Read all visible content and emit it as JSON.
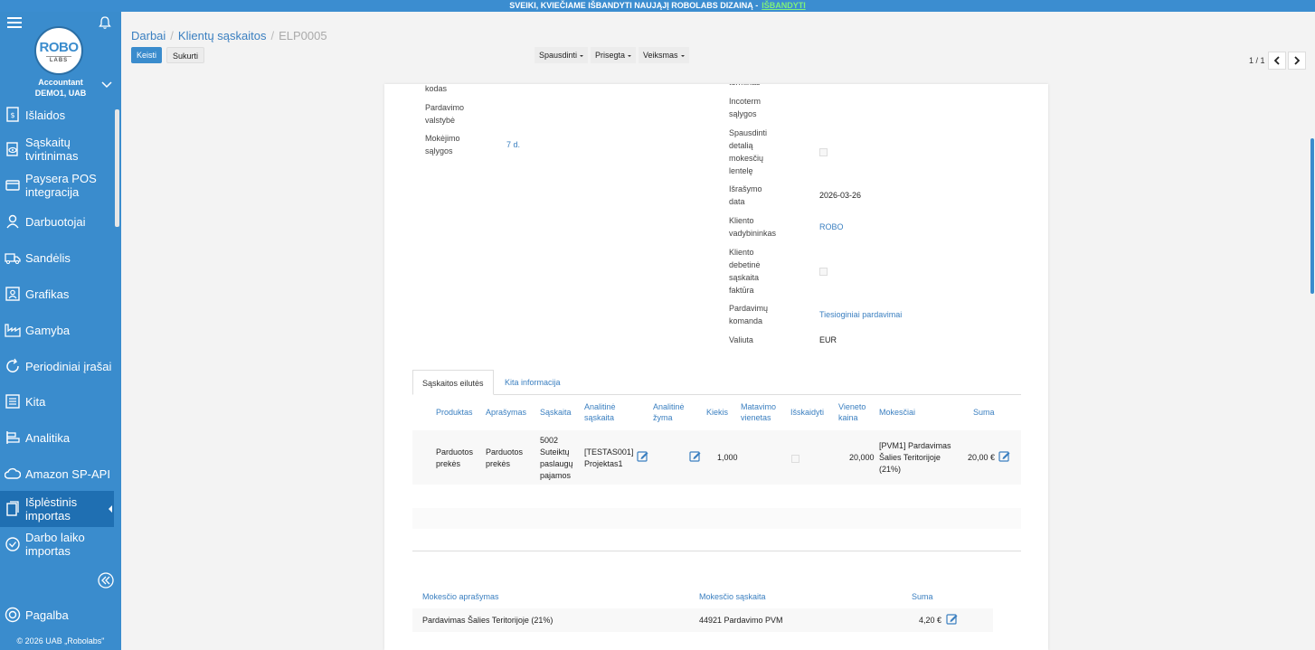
{
  "banner": {
    "text": "SVEIKI, KVIEČIAME IŠBANDYTI NAUJĄJĮ ROBOLABS DIZAINĄ -",
    "link": "IŠBANDYTI"
  },
  "sidebar": {
    "logo_top": "ROBO",
    "logo_bottom": "LABS",
    "role": "Accountant",
    "company": "DEMO1, UAB",
    "items": [
      {
        "label": "Išlaidos",
        "icon": "receipt-icon"
      },
      {
        "label": "Sąskaitų tvirtinimas",
        "icon": "eye-document-icon"
      },
      {
        "label": "Paysera POS integracija",
        "icon": "card-icon"
      },
      {
        "label": "Darbuotojai",
        "icon": "person-icon"
      },
      {
        "label": "Sandėlis",
        "icon": "truck-icon"
      },
      {
        "label": "Grafikas",
        "icon": "calendar-person-icon"
      },
      {
        "label": "Gamyba",
        "icon": "factory-icon"
      },
      {
        "label": "Periodiniai įrašai",
        "icon": "refresh-icon"
      },
      {
        "label": "Kita",
        "icon": "list-icon"
      },
      {
        "label": "Analitika",
        "icon": "analytics-icon"
      },
      {
        "label": "Amazon SP-API",
        "icon": "cloud-icon"
      },
      {
        "label": "Išplėstinis importas",
        "icon": "import-icon"
      },
      {
        "label": "Darbo laiko importas",
        "icon": "clock-icon"
      }
    ],
    "help": "Pagalba",
    "copyright": "© 2026 UAB „Robolabs\""
  },
  "header": {
    "breadcrumb": [
      "Darbai",
      "Klientų sąskaitos",
      "ELP0005"
    ],
    "edit_label": "Keisti",
    "create_label": "Sukurti",
    "print_label": "Spausdinti",
    "attach_label": "Prisegta",
    "action_label": "Veiksmas",
    "pager": "1 / 1"
  },
  "form": {
    "left": {
      "code_label": "kodas",
      "country_label": "Pardavimo valstybė",
      "payment_label": "Mokėjimo sąlygos",
      "payment_value": "7 d."
    },
    "right": {
      "term_label": "terminas",
      "incoterm_label": "Incoterm sąlygos",
      "print_tax_label": "Spausdinti detalią mokesčių lentelę",
      "date_label": "Išrašymo data",
      "date_value": "2026-03-26",
      "manager_label": "Kliento vadybininkas",
      "manager_value": "ROBO",
      "debit_label": "Kliento debetinė sąskaita faktūra",
      "team_label": "Pardavimų komanda",
      "team_value": "Tiesioginiai pardavimai",
      "currency_label": "Valiuta",
      "currency_value": "EUR"
    }
  },
  "tabs": [
    "Sąskaitos eilutės",
    "Kita informacija"
  ],
  "lines": {
    "headers": [
      "Produktas",
      "Aprašymas",
      "Sąskaita",
      "Analitinė sąskaita",
      "Analitinė žyma",
      "Kiekis",
      "Matavimo vienetas",
      "Išskaidyti",
      "Vieneto kaina",
      "Mokesčiai",
      "Suma"
    ],
    "row": {
      "product": "Parduotos prekės",
      "description": "Parduotos prekės",
      "account": "5002 Suteiktų paslaugų pajamos",
      "analytic": "[TESTAS001] Projektas1",
      "qty": "1,000",
      "unit_price": "20,000",
      "taxes": "[PVM1] Pardavimas Šalies Teritorijoje (21%)",
      "amount": "20,00 €"
    }
  },
  "taxes": {
    "headers": [
      "Mokesčio aprašymas",
      "Mokesčio sąskaita",
      "Suma"
    ],
    "row": {
      "description": "Pardavimas Šalies Teritorijoje (21%)",
      "account": "44921 Pardavimo PVM",
      "amount": "4,20 €"
    }
  }
}
